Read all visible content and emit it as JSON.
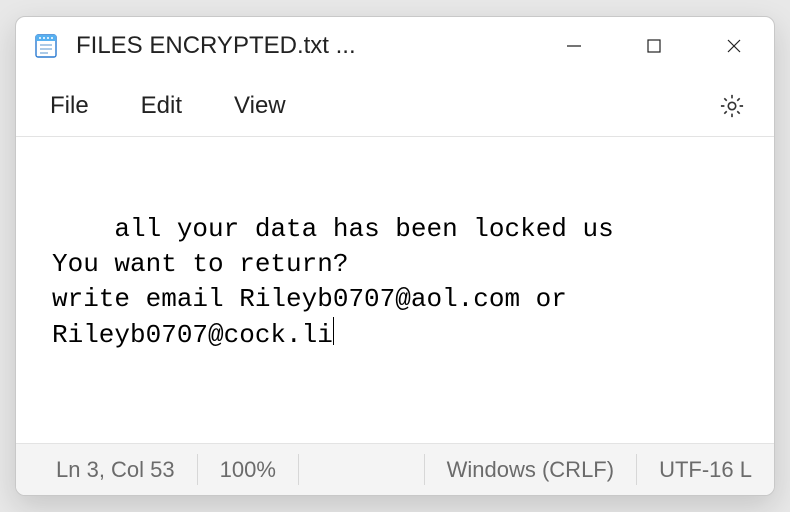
{
  "window": {
    "title": "FILES ENCRYPTED.txt ..."
  },
  "menu": {
    "file": "File",
    "edit": "Edit",
    "view": "View"
  },
  "content": {
    "text": "all your data has been locked us\nYou want to return?\nwrite email Rileyb0707@aol.com or Rileyb0707@cock.li"
  },
  "status": {
    "position": "Ln 3, Col 53",
    "zoom": "100%",
    "line_ending": "Windows (CRLF)",
    "encoding": "UTF-16 L"
  },
  "icons": {
    "app": "notepad-icon",
    "minimize": "minimize-icon",
    "maximize": "maximize-icon",
    "close": "close-icon",
    "settings": "gear-icon"
  }
}
